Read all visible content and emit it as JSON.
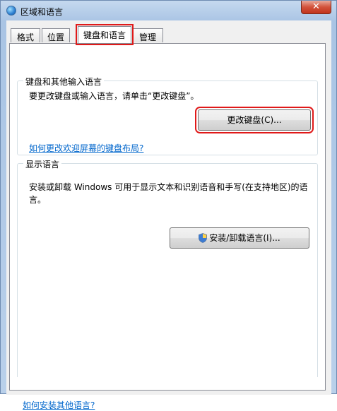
{
  "window": {
    "title": "区域和语言",
    "close_label": "✕"
  },
  "tabs": [
    {
      "label": "格式"
    },
    {
      "label": "位置"
    },
    {
      "label": "键盘和语言"
    },
    {
      "label": "管理"
    }
  ],
  "keyboard_group": {
    "title": "键盘和其他输入语言",
    "description": "要更改键盘或输入语言，请单击“更改键盘”。",
    "change_button": "更改键盘(C)...",
    "link": "如何更改欢迎屏幕的键盘布局?"
  },
  "display_group": {
    "title": "显示语言",
    "description": "安装或卸载 Windows 可用于显示文本和识别语音和手写(在支持地区)的语言。",
    "install_button": "安装/卸载语言(I)..."
  },
  "footer_link": "如何安装其他语言?",
  "colors": {
    "highlight": "#e01919",
    "link": "#0066cc"
  }
}
